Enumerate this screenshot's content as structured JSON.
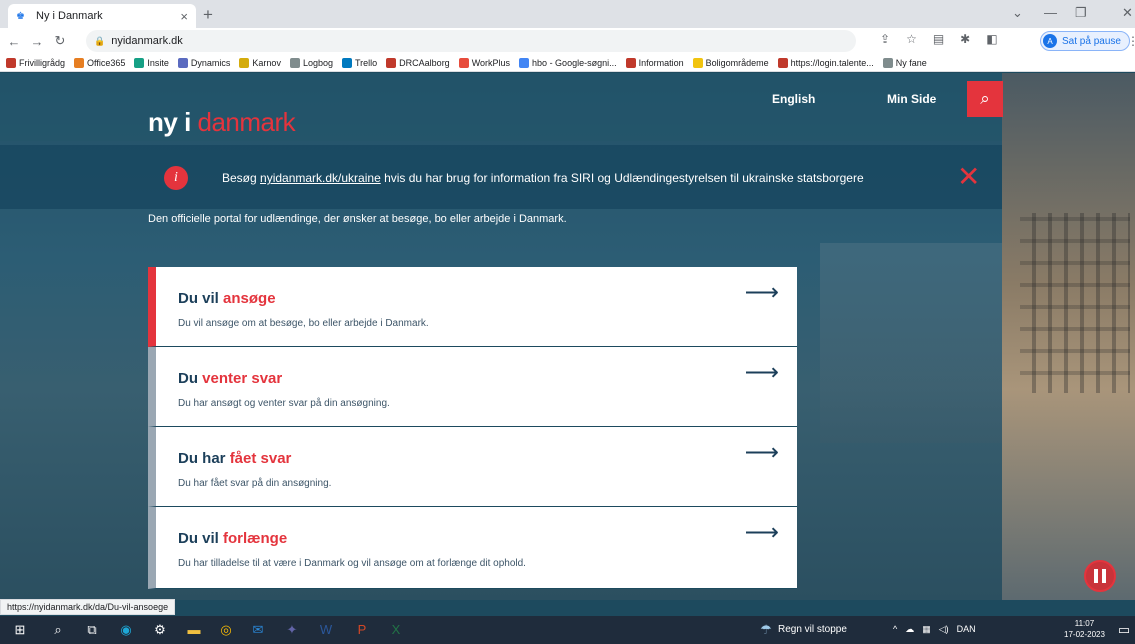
{
  "browser": {
    "tab_title": "Ny i Danmark",
    "tab_close": "×",
    "new_tab": "+",
    "url": "nyidanmark.dk",
    "profile_initial": "A",
    "profile_label": "Sat på pause",
    "bookmarks": [
      {
        "label": "Frivilligrådg",
        "color": "#c0392b"
      },
      {
        "label": "Office365",
        "color": "#e67e22"
      },
      {
        "label": "Insite",
        "color": "#16a085"
      },
      {
        "label": "Dynamics",
        "color": "#5b6bc0"
      },
      {
        "label": "Karnov",
        "color": "#d4ac0d"
      },
      {
        "label": "Logbog",
        "color": "#7f8c8d"
      },
      {
        "label": "Trello",
        "color": "#0079bf"
      },
      {
        "label": "DRCAalborg",
        "color": "#c0392b"
      },
      {
        "label": "WorkPlus",
        "color": "#e74c3c"
      },
      {
        "label": "hbo - Google-søgni...",
        "color": "#4285f4"
      },
      {
        "label": "Information",
        "color": "#c0392b"
      },
      {
        "label": "Boligområdeme",
        "color": "#f1c40f"
      },
      {
        "label": "https://login.talente...",
        "color": "#c0392b"
      },
      {
        "label": "Ny fane",
        "color": "#7f8c8d"
      }
    ]
  },
  "site": {
    "logo_main": "ny i ",
    "logo_red": "danmark",
    "nav_english": "English",
    "nav_minside": "Min Side",
    "banner_prefix": "Besøg ",
    "banner_link": "nyidanmark.dk/ukraine",
    "banner_suffix": " hvis du har brug for information fra SIRI og Udlændingestyrelsen til ukrainske statsborgere",
    "tagline": "Den officielle portal for udlændinge, der ønsker at besøge, bo eller arbejde i Danmark.",
    "cards": [
      {
        "title_plain": "Du vil ",
        "title_hl": "ansøge",
        "desc": "Du vil ansøge om at besøge, bo eller arbejde i Danmark."
      },
      {
        "title_plain": "Du ",
        "title_hl": "venter svar",
        "desc": "Du har ansøgt og venter svar på din ansøgning."
      },
      {
        "title_plain": "Du har ",
        "title_hl": "fået svar",
        "desc": "Du har fået svar på din ansøgning."
      },
      {
        "title_plain": "Du vil ",
        "title_hl": "forlænge",
        "desc": "Du har tilladelse til at være i Danmark og vil ansøge om at forlænge dit ophold."
      }
    ],
    "arrow": "⟶"
  },
  "status_url": "https://nyidanmark.dk/da/Du-vil-ansoege",
  "taskbar": {
    "weather": "Regn vil stoppe",
    "lang": "DAN",
    "time": "11:07",
    "date": "17-02-2023"
  },
  "colors": {
    "accent": "#e4343d",
    "navy": "#1c3f5a"
  }
}
